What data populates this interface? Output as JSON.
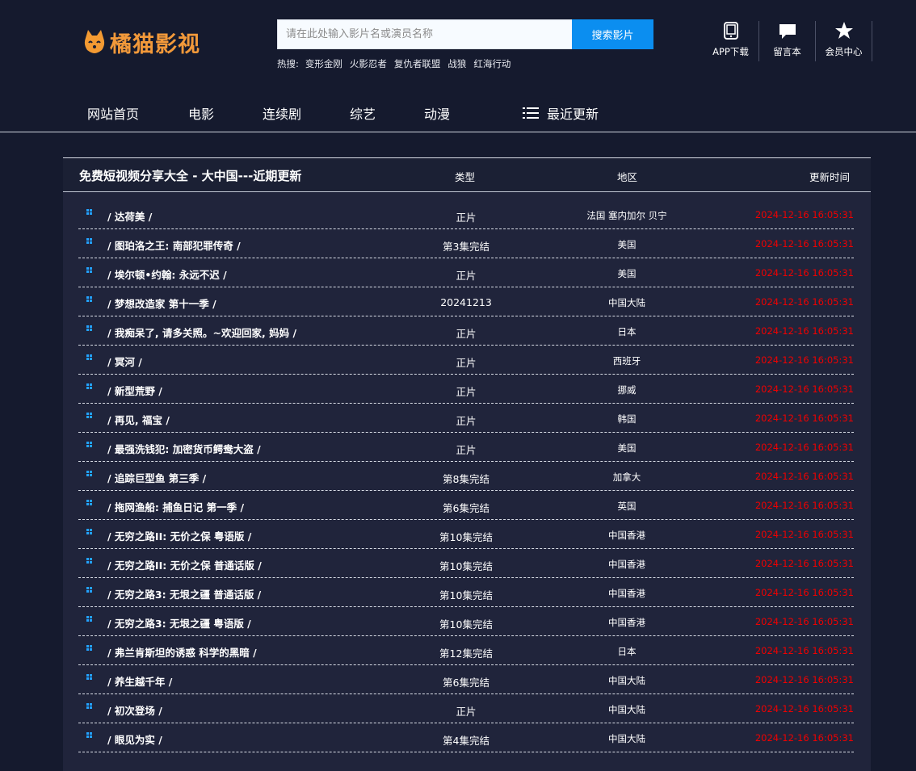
{
  "header": {
    "logo_text": "橘猫影视",
    "search": {
      "placeholder": "请在此处输入影片名或演员名称",
      "button": "搜索影片"
    },
    "hot": {
      "label": "热搜:",
      "items": [
        "变形金刚",
        "火影忍者",
        "复仇者联盟",
        "战狼",
        "红海行动"
      ]
    },
    "tools": [
      {
        "label": "APP下载",
        "icon": "tablet-icon"
      },
      {
        "label": "留言本",
        "icon": "message-icon"
      },
      {
        "label": "会员中心",
        "icon": "star-icon"
      }
    ],
    "nav": [
      "网站首页",
      "电影",
      "连续剧",
      "综艺",
      "动漫",
      "最近更新"
    ]
  },
  "panel": {
    "title": "免费短视频分享大全 - 大中国---近期更新",
    "columns": {
      "type": "类型",
      "area": "地区",
      "time": "更新时间"
    },
    "rows": [
      {
        "name": "/ 达荷美 /",
        "type": "正片",
        "area": "法国 塞内加尔 贝宁",
        "time": "2024-12-16 16:05:31"
      },
      {
        "name": "/ 图珀洛之王: 南部犯罪传奇 /",
        "type": "第3集完结",
        "area": "美国",
        "time": "2024-12-16 16:05:31"
      },
      {
        "name": "/ 埃尔顿•约翰: 永远不迟 /",
        "type": "正片",
        "area": "美国",
        "time": "2024-12-16 16:05:31"
      },
      {
        "name": "/ 梦想改造家 第十一季 /",
        "type": "20241213",
        "area": "中国大陆",
        "time": "2024-12-16 16:05:31"
      },
      {
        "name": "/ 我痴呆了, 请多关照。~欢迎回家, 妈妈 /",
        "type": "正片",
        "area": "日本",
        "time": "2024-12-16 16:05:31"
      },
      {
        "name": "/ 冥河 /",
        "type": "正片",
        "area": "西班牙",
        "time": "2024-12-16 16:05:31"
      },
      {
        "name": "/ 新型荒野 /",
        "type": "正片",
        "area": "挪威",
        "time": "2024-12-16 16:05:31"
      },
      {
        "name": "/ 再见, 福宝 /",
        "type": "正片",
        "area": "韩国",
        "time": "2024-12-16 16:05:31"
      },
      {
        "name": "/ 最强洗钱犯: 加密货币鳄鸯大盗 /",
        "type": "正片",
        "area": "美国",
        "time": "2024-12-16 16:05:31"
      },
      {
        "name": "/ 追踪巨型鱼 第三季 /",
        "type": "第8集完结",
        "area": "加拿大",
        "time": "2024-12-16 16:05:31"
      },
      {
        "name": "/ 拖网渔船: 捕鱼日记 第一季 /",
        "type": "第6集完结",
        "area": "英国",
        "time": "2024-12-16 16:05:31"
      },
      {
        "name": "/ 无穷之路II: 无价之保 粤语版 /",
        "type": "第10集完结",
        "area": "中国香港",
        "time": "2024-12-16 16:05:31"
      },
      {
        "name": "/ 无穷之路II: 无价之保 普通话版 /",
        "type": "第10集完结",
        "area": "中国香港",
        "time": "2024-12-16 16:05:31"
      },
      {
        "name": "/ 无穷之路3: 无垠之疆 普通话版 /",
        "type": "第10集完结",
        "area": "中国香港",
        "time": "2024-12-16 16:05:31"
      },
      {
        "name": "/ 无穷之路3: 无垠之疆 粤语版 /",
        "type": "第10集完结",
        "area": "中国香港",
        "time": "2024-12-16 16:05:31"
      },
      {
        "name": "/ 弗兰肯斯坦的诱惑 科学的黑暗 /",
        "type": "第12集完结",
        "area": "日本",
        "time": "2024-12-16 16:05:31"
      },
      {
        "name": "/ 养生越千年 /",
        "type": "第6集完结",
        "area": "中国大陆",
        "time": "2024-12-16 16:05:31"
      },
      {
        "name": "/ 初次登场 /",
        "type": "正片",
        "area": "中国大陆",
        "time": "2024-12-16 16:05:31"
      },
      {
        "name": "/ 眼见为实 /",
        "type": "第4集完结",
        "area": "中国大陆",
        "time": "2024-12-16 16:05:31"
      }
    ]
  }
}
